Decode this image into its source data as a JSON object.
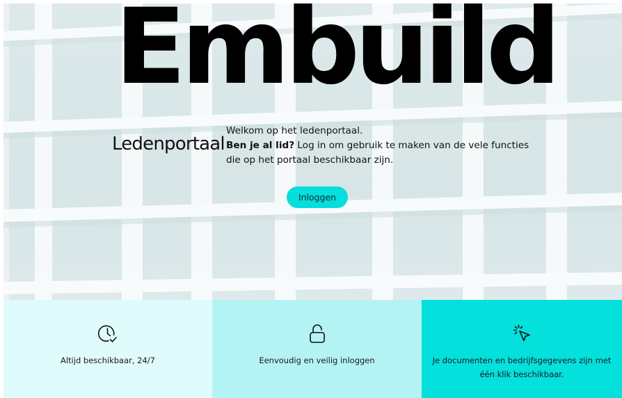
{
  "hero": {
    "brand": "Embuild",
    "subtitle": "Ledenportaal",
    "welcome_line": "Welkom op het ledenportaal.",
    "member_question": "Ben je al lid?",
    "member_text": " Log in om gebruik te maken van de vele functies die op het portaal beschikbaar zijn.",
    "login_label": "Inloggen"
  },
  "features": [
    {
      "icon": "clock-check-icon",
      "text": "Altijd beschikbaar, 24/7"
    },
    {
      "icon": "lock-icon",
      "text": "Eenvoudig en veilig inloggen"
    },
    {
      "icon": "cursor-click-icon",
      "text": "Je documenten en bedrijfsgegevens zijn met één klik beschikbaar."
    }
  ],
  "colors": {
    "accent": "#06dddd",
    "feature_light": "#e0fbfb",
    "feature_mid": "#b4f3f3",
    "feature_strong": "#04e0dc"
  }
}
